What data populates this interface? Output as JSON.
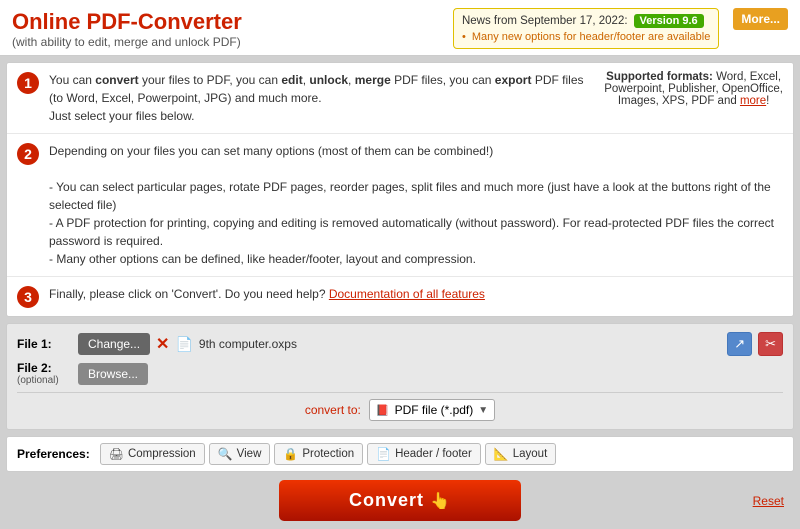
{
  "header": {
    "title": "Online PDF-Converter",
    "subtitle": "(with ability to edit, merge and unlock PDF)",
    "news_label": "News from September 17, 2022:",
    "version_badge": "Version 9.6",
    "news_bullet": "Many new options for header/footer are available",
    "more_btn": "More..."
  },
  "steps": [
    {
      "number": "1",
      "text_html": "You can <b>convert</b> your files to PDF, you can <b>edit</b>, <b>unlock</b>, <b>merge</b> PDF files, you can <b>export</b> PDF files (to Word, Excel, Powerpoint, JPG) and much more.<br>Just select your files below.",
      "side_html": "<b>Supported formats:</b> Word, Excel,<br>Powerpoint, Publisher, OpenOffice,<br>Images, XPS, PDF and <a href='#'>more</a>!"
    },
    {
      "number": "2",
      "text_html": "Depending on your files you can set many options (most of them can be combined!)<br><br>- You can select particular pages, rotate PDF pages, reorder pages, split files and much more (just have a look at the buttons right of the selected file)<br>- A PDF protection for printing, copying and editing is removed automatically (without password). For read-protected PDF files the correct password is required.<br>- Many other options can be defined, like header/footer, layout and compression.",
      "side_html": ""
    },
    {
      "number": "3",
      "text_html": "Finally, please click on 'Convert'. Do you need help? <a href='#'>Documentation of all features</a>",
      "side_html": ""
    }
  ],
  "files": {
    "file1_label": "File 1:",
    "file1_change_btn": "Change...",
    "file1_name": "9th computer.oxps",
    "file2_label": "File 2:",
    "file2_optional": "(optional)",
    "file2_browse_btn": "Browse...",
    "convert_to_label": "convert to:",
    "convert_to_value": "PDF file (*.pdf)"
  },
  "preferences": {
    "label": "Preferences:",
    "tabs": [
      {
        "id": "compression",
        "icon": "🖨",
        "label": "Compression"
      },
      {
        "id": "view",
        "icon": "🔍",
        "label": "View"
      },
      {
        "id": "protection",
        "icon": "🔒",
        "label": "Protection"
      },
      {
        "id": "header-footer",
        "icon": "📄",
        "label": "Header / footer"
      },
      {
        "id": "layout",
        "icon": "📐",
        "label": "Layout"
      }
    ]
  },
  "convert_btn": "Convert",
  "reset_link": "Reset"
}
